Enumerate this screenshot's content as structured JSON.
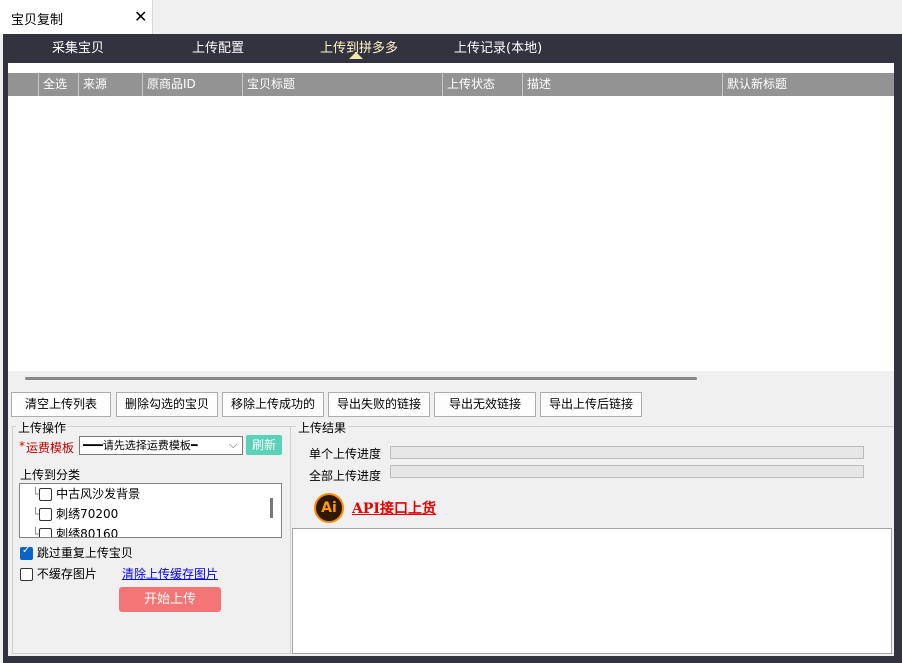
{
  "window": {
    "tab_title": "宝贝复制",
    "close_glyph": "✕"
  },
  "nav": {
    "items": [
      {
        "label": "采集宝贝"
      },
      {
        "label": "上传配置"
      },
      {
        "label": "上传到拼多多"
      },
      {
        "label": "上传记录(本地)"
      }
    ],
    "active_index": 2
  },
  "grid": {
    "columns": [
      "",
      "全选",
      "来源",
      "原商品ID",
      "宝贝标题",
      "上传状态",
      "描述",
      "默认新标题"
    ],
    "rows": []
  },
  "actions": {
    "clear_list": "清空上传列表",
    "delete_checked": "删除勾选的宝贝",
    "remove_success": "移除上传成功的",
    "export_failed": "导出失败的链接",
    "export_invalid": "导出无效链接",
    "export_uploaded": "导出上传后链接"
  },
  "upload_ops": {
    "title": "上传操作",
    "fee_required_mark": "*",
    "fee_label": "运费模板",
    "fee_select_value": "━━━请先选择运费模板━",
    "refresh_label": "刷新",
    "category_label": "上传到分类",
    "categories": [
      {
        "label": "中古风沙发背景",
        "checked": false
      },
      {
        "label": "刺绣70200",
        "checked": false
      },
      {
        "label": "刺绣80160",
        "checked": false
      }
    ],
    "skip_duplicate": {
      "label": "跳过重复上传宝贝",
      "checked": true
    },
    "no_cache_images": {
      "label": "不缓存图片",
      "checked": false
    },
    "clear_cache_link": "清除上传缓存图片",
    "start_button": "开始上传"
  },
  "upload_result": {
    "title": "上传结果",
    "single_progress_label": "单个上传进度",
    "single_progress": 0,
    "all_progress_label": "全部上传进度",
    "all_progress": 0,
    "ai_icon_text": "Ai",
    "api_link": "API接口上货"
  },
  "colors": {
    "frame": "#33323f",
    "active_caret": "#f1e9a8",
    "grid_header": "#939393",
    "refresh_button": "#5ad2b7",
    "start_button": "#f47575",
    "api_link": "#e60000"
  }
}
